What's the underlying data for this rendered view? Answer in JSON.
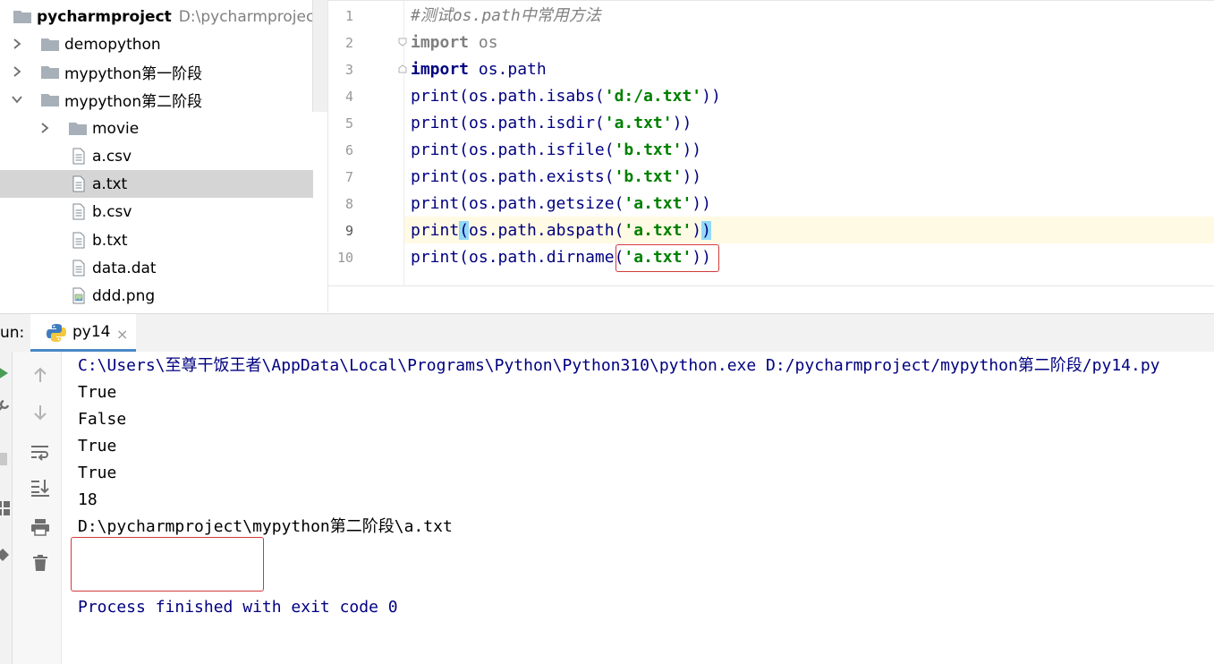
{
  "project": {
    "root_name": "pycharmproject",
    "root_path": "D:\\pycharmproject",
    "items": [
      {
        "label": "demopython",
        "kind": "folder",
        "expanded": false
      },
      {
        "label": "mypython第一阶段",
        "kind": "folder",
        "expanded": false
      },
      {
        "label": "mypython第二阶段",
        "kind": "folder",
        "expanded": true
      },
      {
        "label": "movie",
        "kind": "folder",
        "expanded": false
      },
      {
        "label": "a.csv",
        "kind": "file"
      },
      {
        "label": "a.txt",
        "kind": "file",
        "selected": true
      },
      {
        "label": "b.csv",
        "kind": "file"
      },
      {
        "label": "b.txt",
        "kind": "file"
      },
      {
        "label": "data.dat",
        "kind": "file"
      },
      {
        "label": "ddd.png",
        "kind": "image"
      }
    ]
  },
  "editor": {
    "current_line": 9,
    "line_numbers": [
      "1",
      "2",
      "3",
      "4",
      "5",
      "6",
      "7",
      "8",
      "9",
      "10"
    ],
    "lines": {
      "l1_comment": "#测试os.path中常用方法",
      "l2_kw": "import",
      "l2_rest": " os",
      "l3_kw": "import",
      "l3_rest": " os.path",
      "l4_pre": "print(os.path.isabs(",
      "l4_str": "'d:/a.txt'",
      "l4_post": "))",
      "l5_pre": "print(os.path.isdir(",
      "l5_str": "'a.txt'",
      "l5_post": "))",
      "l6_pre": "print(os.path.isfile(",
      "l6_str": "'b.txt'",
      "l6_post": "))",
      "l7_pre": "print(os.path.exists(",
      "l7_str": "'b.txt'",
      "l7_post": "))",
      "l8_pre": "print(os.path.getsize(",
      "l8_str": "'a.txt'",
      "l8_post": "))",
      "l9_a": "print",
      "l9_b": "(",
      "l9_c": "os.path.abspath(",
      "l9_str": "'a.txt'",
      "l9_d": ")",
      "l9_e": ")",
      "l10_pre": "print(os.path.dirname",
      "l10_open": "(",
      "l10_str": "'a.txt'",
      "l10_post": "))"
    }
  },
  "run": {
    "label": "un:",
    "tab_label": "py14",
    "close_glyph": "×",
    "command": "C:\\Users\\至尊干饭王者\\AppData\\Local\\Programs\\Python\\Python310\\python.exe D:/pycharmproject/mypython第二阶段/py14.py",
    "output": [
      "True",
      "False",
      "True",
      "True",
      "18",
      "D:\\pycharmproject\\mypython第二阶段\\a.txt"
    ],
    "exit_message": "Process finished with exit code 0"
  },
  "colors": {
    "keyword": "#000080",
    "string": "#008000",
    "comment": "#808080",
    "caret_row": "#fffae3",
    "selection": "#d5d5d5",
    "annotation": "#d33a3a"
  },
  "icons": [
    "folder-icon",
    "file-text-icon",
    "image-file-icon",
    "chevron-right-icon",
    "chevron-down-icon",
    "python-icon",
    "rerun-icon",
    "wrench-icon",
    "stop-icon",
    "up-arrow-icon",
    "down-arrow-icon",
    "soft-wrap-icon",
    "scroll-to-end-icon",
    "print-icon",
    "trash-icon",
    "layout-icon",
    "pin-icon"
  ]
}
